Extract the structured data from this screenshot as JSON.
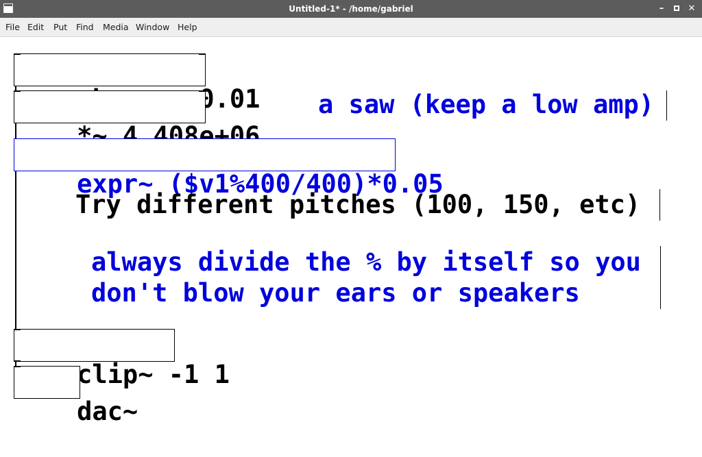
{
  "window": {
    "title": "Untitled-1* - /home/gabriel"
  },
  "menubar": {
    "items": [
      "File",
      "Edit",
      "Put",
      "Find",
      "Media",
      "Window",
      "Help"
    ]
  },
  "patch": {
    "objects": {
      "phasor": "phasor~ 0.01",
      "multiply": "*~ 4.408e+06",
      "expr": "expr~ ($v1%400/400)*0.05",
      "clip": "clip~ -1 1",
      "dac": "dac~"
    },
    "comments": {
      "saw": "a saw (keep a low amp)",
      "pitches": "Try different pitches (100, 150, etc)",
      "divide_line1": "always divide the % by itself so you",
      "divide_line2": "don't blow your ears or speakers"
    }
  },
  "colors": {
    "selection": "#0000dd",
    "titlebar": "#5c5c5c",
    "menubar": "#efefef"
  }
}
